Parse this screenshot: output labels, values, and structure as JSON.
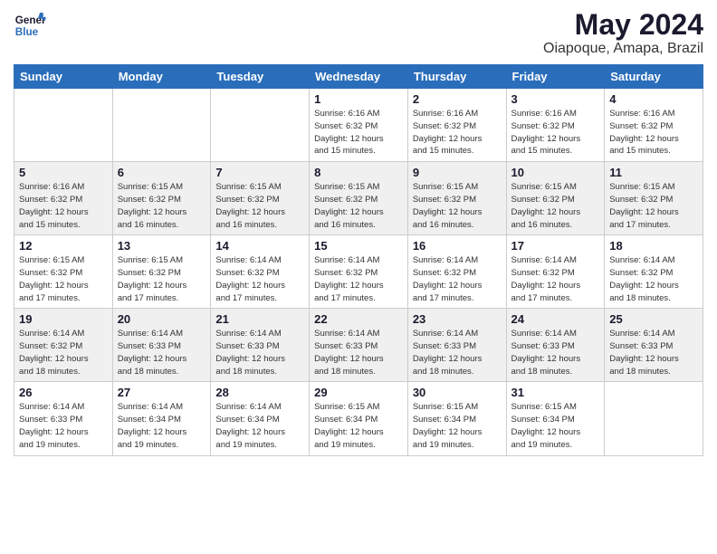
{
  "logo": {
    "name_part1": "General",
    "name_part2": "Blue"
  },
  "title": {
    "month_year": "May 2024",
    "location": "Oiapoque, Amapa, Brazil"
  },
  "weekdays": [
    "Sunday",
    "Monday",
    "Tuesday",
    "Wednesday",
    "Thursday",
    "Friday",
    "Saturday"
  ],
  "weeks": [
    [
      {
        "day": "",
        "info": ""
      },
      {
        "day": "",
        "info": ""
      },
      {
        "day": "",
        "info": ""
      },
      {
        "day": "1",
        "info": "Sunrise: 6:16 AM\nSunset: 6:32 PM\nDaylight: 12 hours\nand 15 minutes."
      },
      {
        "day": "2",
        "info": "Sunrise: 6:16 AM\nSunset: 6:32 PM\nDaylight: 12 hours\nand 15 minutes."
      },
      {
        "day": "3",
        "info": "Sunrise: 6:16 AM\nSunset: 6:32 PM\nDaylight: 12 hours\nand 15 minutes."
      },
      {
        "day": "4",
        "info": "Sunrise: 6:16 AM\nSunset: 6:32 PM\nDaylight: 12 hours\nand 15 minutes."
      }
    ],
    [
      {
        "day": "5",
        "info": "Sunrise: 6:16 AM\nSunset: 6:32 PM\nDaylight: 12 hours\nand 15 minutes."
      },
      {
        "day": "6",
        "info": "Sunrise: 6:15 AM\nSunset: 6:32 PM\nDaylight: 12 hours\nand 16 minutes."
      },
      {
        "day": "7",
        "info": "Sunrise: 6:15 AM\nSunset: 6:32 PM\nDaylight: 12 hours\nand 16 minutes."
      },
      {
        "day": "8",
        "info": "Sunrise: 6:15 AM\nSunset: 6:32 PM\nDaylight: 12 hours\nand 16 minutes."
      },
      {
        "day": "9",
        "info": "Sunrise: 6:15 AM\nSunset: 6:32 PM\nDaylight: 12 hours\nand 16 minutes."
      },
      {
        "day": "10",
        "info": "Sunrise: 6:15 AM\nSunset: 6:32 PM\nDaylight: 12 hours\nand 16 minutes."
      },
      {
        "day": "11",
        "info": "Sunrise: 6:15 AM\nSunset: 6:32 PM\nDaylight: 12 hours\nand 17 minutes."
      }
    ],
    [
      {
        "day": "12",
        "info": "Sunrise: 6:15 AM\nSunset: 6:32 PM\nDaylight: 12 hours\nand 17 minutes."
      },
      {
        "day": "13",
        "info": "Sunrise: 6:15 AM\nSunset: 6:32 PM\nDaylight: 12 hours\nand 17 minutes."
      },
      {
        "day": "14",
        "info": "Sunrise: 6:14 AM\nSunset: 6:32 PM\nDaylight: 12 hours\nand 17 minutes."
      },
      {
        "day": "15",
        "info": "Sunrise: 6:14 AM\nSunset: 6:32 PM\nDaylight: 12 hours\nand 17 minutes."
      },
      {
        "day": "16",
        "info": "Sunrise: 6:14 AM\nSunset: 6:32 PM\nDaylight: 12 hours\nand 17 minutes."
      },
      {
        "day": "17",
        "info": "Sunrise: 6:14 AM\nSunset: 6:32 PM\nDaylight: 12 hours\nand 17 minutes."
      },
      {
        "day": "18",
        "info": "Sunrise: 6:14 AM\nSunset: 6:32 PM\nDaylight: 12 hours\nand 18 minutes."
      }
    ],
    [
      {
        "day": "19",
        "info": "Sunrise: 6:14 AM\nSunset: 6:32 PM\nDaylight: 12 hours\nand 18 minutes."
      },
      {
        "day": "20",
        "info": "Sunrise: 6:14 AM\nSunset: 6:33 PM\nDaylight: 12 hours\nand 18 minutes."
      },
      {
        "day": "21",
        "info": "Sunrise: 6:14 AM\nSunset: 6:33 PM\nDaylight: 12 hours\nand 18 minutes."
      },
      {
        "day": "22",
        "info": "Sunrise: 6:14 AM\nSunset: 6:33 PM\nDaylight: 12 hours\nand 18 minutes."
      },
      {
        "day": "23",
        "info": "Sunrise: 6:14 AM\nSunset: 6:33 PM\nDaylight: 12 hours\nand 18 minutes."
      },
      {
        "day": "24",
        "info": "Sunrise: 6:14 AM\nSunset: 6:33 PM\nDaylight: 12 hours\nand 18 minutes."
      },
      {
        "day": "25",
        "info": "Sunrise: 6:14 AM\nSunset: 6:33 PM\nDaylight: 12 hours\nand 18 minutes."
      }
    ],
    [
      {
        "day": "26",
        "info": "Sunrise: 6:14 AM\nSunset: 6:33 PM\nDaylight: 12 hours\nand 19 minutes."
      },
      {
        "day": "27",
        "info": "Sunrise: 6:14 AM\nSunset: 6:34 PM\nDaylight: 12 hours\nand 19 minutes."
      },
      {
        "day": "28",
        "info": "Sunrise: 6:14 AM\nSunset: 6:34 PM\nDaylight: 12 hours\nand 19 minutes."
      },
      {
        "day": "29",
        "info": "Sunrise: 6:15 AM\nSunset: 6:34 PM\nDaylight: 12 hours\nand 19 minutes."
      },
      {
        "day": "30",
        "info": "Sunrise: 6:15 AM\nSunset: 6:34 PM\nDaylight: 12 hours\nand 19 minutes."
      },
      {
        "day": "31",
        "info": "Sunrise: 6:15 AM\nSunset: 6:34 PM\nDaylight: 12 hours\nand 19 minutes."
      },
      {
        "day": "",
        "info": ""
      }
    ]
  ]
}
